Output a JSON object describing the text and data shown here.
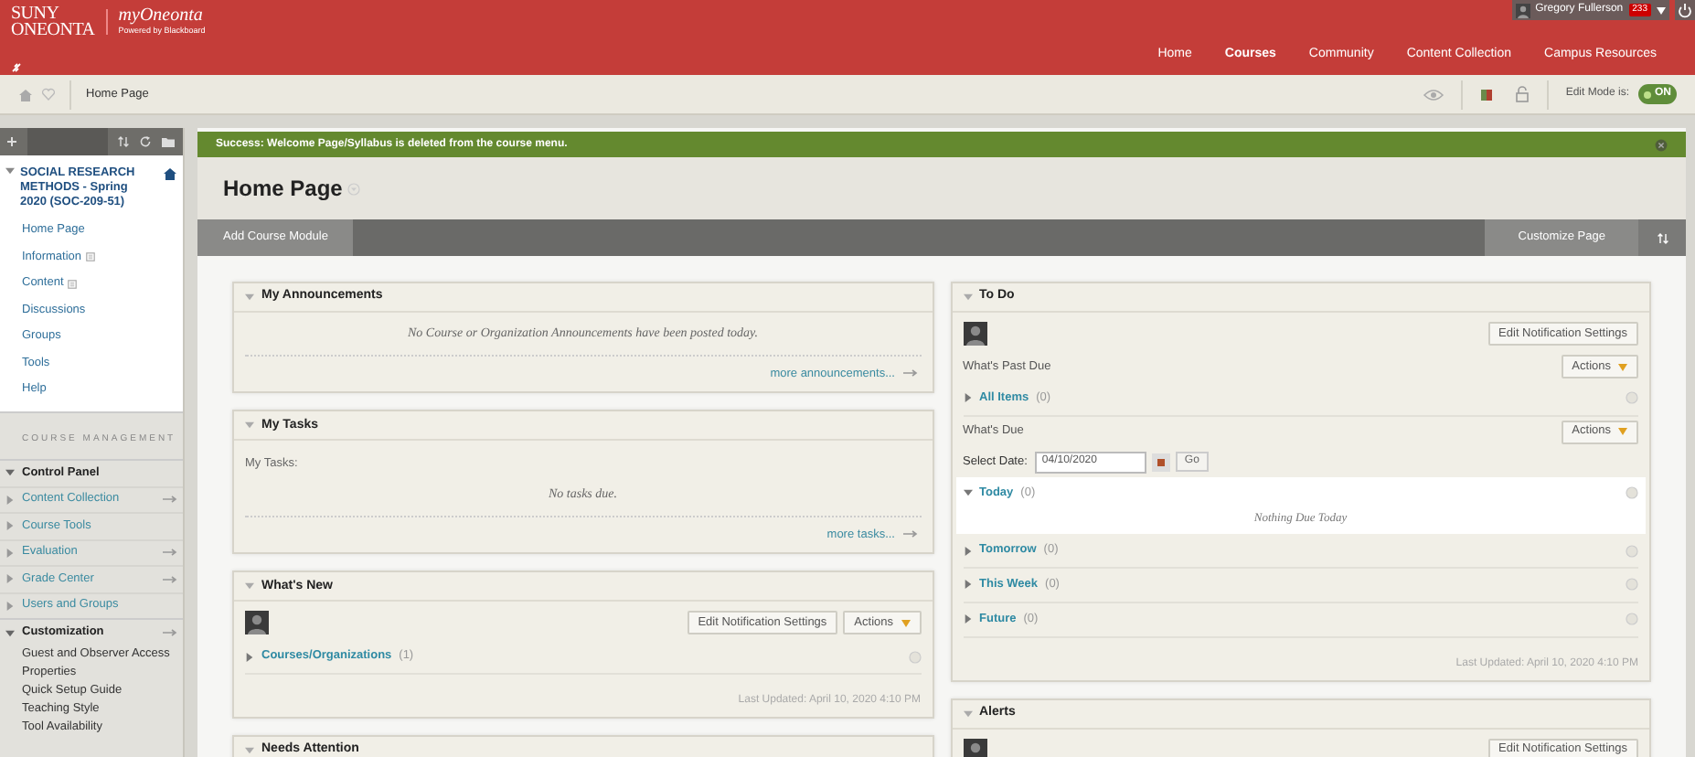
{
  "header": {
    "logo_lines": [
      "SUNY",
      "ONEONTA"
    ],
    "brand": "myOneonta",
    "brand_sub": "Powered by Blackboard",
    "user": "Gregory Fullerson",
    "badge": "233"
  },
  "nav": [
    {
      "label": "Home",
      "selected": false
    },
    {
      "label": "Courses",
      "selected": true
    },
    {
      "label": "Community",
      "selected": false
    },
    {
      "label": "Content Collection",
      "selected": false
    },
    {
      "label": "Campus Resources",
      "selected": false
    }
  ],
  "breadcrumb": {
    "label": "Home Page"
  },
  "edit_mode": {
    "label": "Edit Mode is:",
    "state": "ON",
    "on": true
  },
  "sidebar": {
    "course_title": "SOCIAL RESEARCH METHODS - Spring 2020 (SOC-209-51)",
    "course_expanded": true,
    "items": [
      {
        "label": "Home Page",
        "flag": false
      },
      {
        "label": "Information",
        "flag": true
      },
      {
        "label": "Content",
        "flag": true
      },
      {
        "label": "Discussions",
        "flag": false
      },
      {
        "label": "Groups",
        "flag": false
      },
      {
        "label": "Tools",
        "flag": false
      },
      {
        "label": "Help",
        "flag": false
      }
    ],
    "management_heading": "COURSE MANAGEMENT",
    "sections": [
      {
        "label": "Control Panel",
        "expanded": true,
        "has_arrow": false,
        "items": [
          {
            "label": "Content Collection",
            "expanded": false,
            "has_arrow": true
          },
          {
            "label": "Course Tools",
            "expanded": false,
            "has_arrow": false
          },
          {
            "label": "Evaluation",
            "expanded": false,
            "has_arrow": true
          },
          {
            "label": "Grade Center",
            "expanded": false,
            "has_arrow": true
          },
          {
            "label": "Users and Groups",
            "expanded": false,
            "has_arrow": false
          }
        ]
      },
      {
        "label": "Customization",
        "expanded": true,
        "has_arrow": true,
        "links": [
          "Guest and Observer Access",
          "Properties",
          "Quick Setup Guide",
          "Teaching Style",
          "Tool Availability"
        ]
      }
    ]
  },
  "banner": {
    "message": "Success: Welcome Page/Syllabus is deleted from the course menu."
  },
  "page_title": "Home Page",
  "toolbar": {
    "add_button": "Add Course Module",
    "customize_button": "Customize Page"
  },
  "columns": [
    [
      {
        "title": "My Announcements",
        "expanded": true,
        "blocks": [
          {
            "kind": "message",
            "text": "No Course or Organization Announcements have been posted today."
          },
          {
            "kind": "more",
            "text": "more announcements..."
          }
        ]
      },
      {
        "title": "My Tasks",
        "expanded": true,
        "blocks": [
          {
            "kind": "label",
            "text": "My Tasks:"
          },
          {
            "kind": "message",
            "text": "No tasks due."
          },
          {
            "kind": "more",
            "text": "more tasks..."
          }
        ]
      },
      {
        "title": "What's New",
        "expanded": true,
        "blocks": [
          {
            "kind": "toolbar",
            "buttons": [
              {
                "label": "Edit Notification Settings",
                "menu": false
              },
              {
                "label": "Actions",
                "menu": true
              }
            ]
          },
          {
            "kind": "group",
            "label": "Courses/Organizations",
            "count": "(1)",
            "expanded": false
          },
          {
            "kind": "updated",
            "text": "Last Updated: April 10, 2020 4:10 PM"
          }
        ]
      },
      {
        "title": "Needs Attention",
        "expanded": true
      }
    ],
    [
      {
        "title": "To Do",
        "expanded": true,
        "blocks": [
          {
            "kind": "toolbar",
            "buttons": [
              {
                "label": "Edit Notification Settings",
                "menu": false
              }
            ]
          },
          {
            "kind": "heading",
            "text": "What's Past Due",
            "button": "Actions"
          },
          {
            "kind": "group",
            "label": "All Items",
            "count": "(0)",
            "expanded": false
          },
          {
            "kind": "heading",
            "text": "What's Due",
            "button": "Actions"
          },
          {
            "kind": "date",
            "label": "Select Date:",
            "value": "04/10/2020",
            "button": "Go"
          },
          {
            "kind": "group",
            "label": "Today",
            "count": "(0)",
            "expanded": true,
            "note": "Nothing Due Today"
          },
          {
            "kind": "group",
            "label": "Tomorrow",
            "count": "(0)",
            "expanded": false
          },
          {
            "kind": "group",
            "label": "This Week",
            "count": "(0)",
            "expanded": false
          },
          {
            "kind": "group",
            "label": "Future",
            "count": "(0)",
            "expanded": false
          },
          {
            "kind": "updated",
            "text": "Last Updated: April 10, 2020 4:10 PM"
          }
        ]
      },
      {
        "title": "Alerts",
        "expanded": true,
        "blocks": [
          {
            "kind": "toolbar",
            "buttons": [
              {
                "label": "Edit Notification Settings",
                "menu": false
              }
            ]
          }
        ]
      }
    ]
  ]
}
